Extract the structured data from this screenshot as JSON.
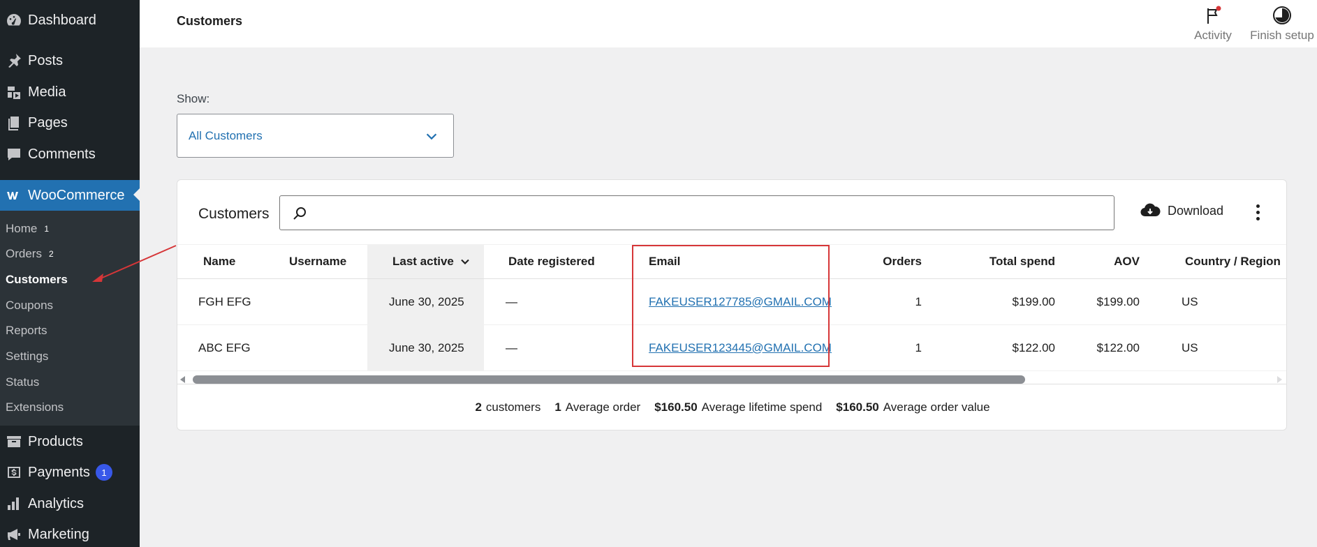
{
  "sidebar": {
    "items": [
      {
        "label": "Dashboard",
        "icon": "dashboard-icon"
      },
      {
        "label": "Posts",
        "icon": "pin-icon"
      },
      {
        "label": "Media",
        "icon": "media-icon"
      },
      {
        "label": "Pages",
        "icon": "pages-icon"
      },
      {
        "label": "Comments",
        "icon": "comment-icon"
      },
      {
        "label": "WooCommerce",
        "icon": "woocommerce-icon"
      },
      {
        "label": "Products",
        "icon": "archive-icon"
      },
      {
        "label": "Payments",
        "icon": "payments-icon",
        "badge": "1"
      },
      {
        "label": "Analytics",
        "icon": "bar-chart-icon"
      },
      {
        "label": "Marketing",
        "icon": "megaphone-icon"
      }
    ],
    "submenu": [
      {
        "label": "Home",
        "count": "1"
      },
      {
        "label": "Orders",
        "count": "2"
      },
      {
        "label": "Customers"
      },
      {
        "label": "Coupons"
      },
      {
        "label": "Reports"
      },
      {
        "label": "Settings"
      },
      {
        "label": "Status"
      },
      {
        "label": "Extensions"
      }
    ]
  },
  "header": {
    "title": "Customers",
    "activity_label": "Activity",
    "finish_setup_label": "Finish setup"
  },
  "filter": {
    "show_label": "Show:",
    "selected": "All Customers"
  },
  "card": {
    "title": "Customers",
    "search_placeholder": "",
    "download_label": "Download"
  },
  "table": {
    "columns": [
      "Name",
      "Username",
      "Last active",
      "Date registered",
      "Email",
      "Orders",
      "Total spend",
      "AOV",
      "Country / Region"
    ],
    "rows": [
      {
        "name": "FGH EFG",
        "username": "",
        "last_active": "June 30, 2025",
        "date_registered": "—",
        "email": "FAKEUSER127785@GMAIL.COM",
        "orders": "1",
        "total_spend": "$199.00",
        "aov": "$199.00",
        "country": "US"
      },
      {
        "name": "ABC EFG",
        "username": "",
        "last_active": "June 30, 2025",
        "date_registered": "—",
        "email": "FAKEUSER123445@GMAIL.COM",
        "orders": "1",
        "total_spend": "$122.00",
        "aov": "$122.00",
        "country": "US"
      }
    ],
    "sorted_column": "Last active"
  },
  "summary": {
    "customers_value": "2",
    "customers_label": "customers",
    "avg_order_value_count": "1",
    "avg_order_label": "Average order",
    "lifetime_value": "$160.50",
    "lifetime_label": "Average lifetime spend",
    "aov_value": "$160.50",
    "aov_label": "Average order value"
  },
  "colors": {
    "sidebar_bg": "#1d2327",
    "active_menu": "#2271b1",
    "link": "#2271b1",
    "highlight_box": "#d63638",
    "badge": "#3858e9"
  }
}
